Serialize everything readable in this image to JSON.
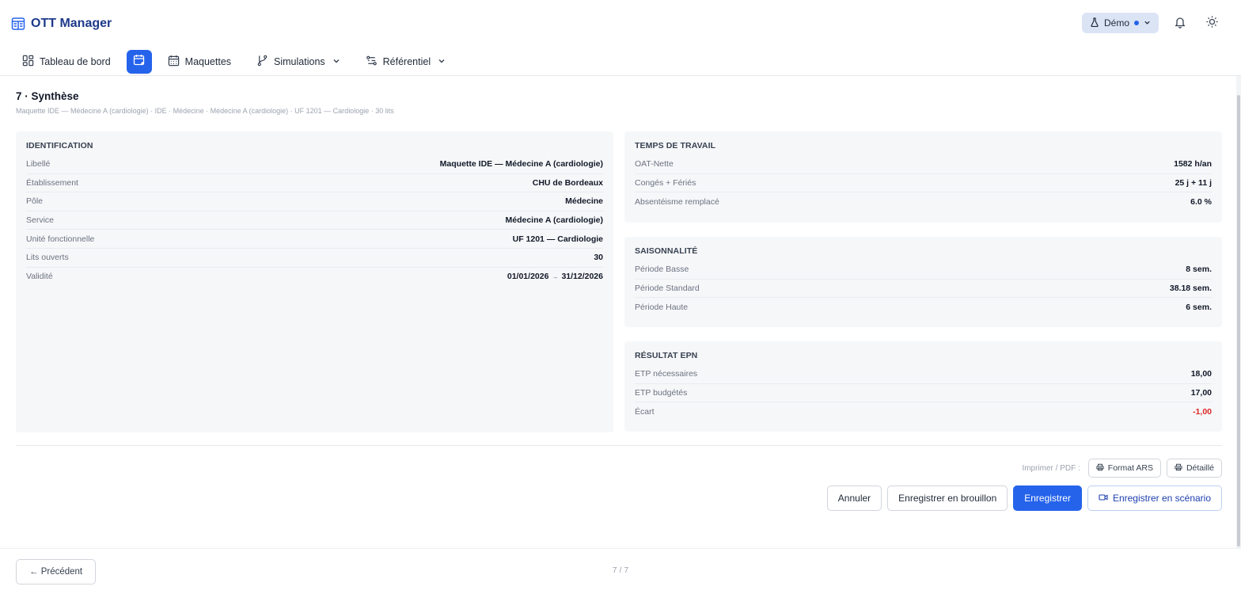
{
  "app": {
    "title": "OTT Manager"
  },
  "header": {
    "demo_label": "Démo"
  },
  "nav": {
    "items": [
      {
        "label": "Tableau de bord"
      },
      {
        "label": ""
      },
      {
        "label": "Maquettes"
      },
      {
        "label": "Simulations"
      },
      {
        "label": "Référentiel"
      }
    ]
  },
  "section": {
    "title": "7 · Synthèse",
    "subtitle": "Maquette IDE — Médecine A (cardiologie) · IDE · Médecine · Médecine A (cardiologie) · UF 1201 — Cardiologie · 30 lits"
  },
  "identification": {
    "title": "IDENTIFICATION",
    "rows": [
      {
        "k": "Libellé",
        "v": "Maquette IDE — Médecine A (cardiologie)"
      },
      {
        "k": "Établissement",
        "v": "CHU de Bordeaux"
      },
      {
        "k": "Pôle",
        "v": "Médecine"
      },
      {
        "k": "Service",
        "v": "Médecine A (cardiologie)"
      },
      {
        "k": "Unité fonctionnelle",
        "v": "UF 1201 — Cardiologie"
      },
      {
        "k": "Lits ouverts",
        "v": "30"
      }
    ],
    "validity": {
      "k": "Validité",
      "from": "01/01/2026",
      "arrow": "→",
      "to": "31/12/2026"
    }
  },
  "temps": {
    "title": "TEMPS DE TRAVAIL",
    "rows": [
      {
        "k": "OAT-Nette",
        "v": "1582 h/an"
      },
      {
        "k": "Congés + Fériés",
        "v": "25 j + 11 j"
      },
      {
        "k": "Absentéisme remplacé",
        "v": "6.0 %"
      }
    ]
  },
  "saison": {
    "title": "SAISONNALITÉ",
    "rows": [
      {
        "k": "Période Basse",
        "v": "8 sem."
      },
      {
        "k": "Période Standard",
        "v": "38.18 sem."
      },
      {
        "k": "Période Haute",
        "v": "6 sem."
      }
    ]
  },
  "epn": {
    "title": "RÉSULTAT EPN",
    "rows": [
      {
        "k": "ETP nécessaires",
        "v": "18,00"
      },
      {
        "k": "ETP budgétés",
        "v": "17,00"
      },
      {
        "k": "Écart",
        "v": "-1,00"
      }
    ]
  },
  "print": {
    "label": "Imprimer / PDF :",
    "format_ars": "Format ARS",
    "detaille": "Détaillé"
  },
  "actions": {
    "cancel": "Annuler",
    "draft": "Enregistrer en brouillon",
    "save": "Enregistrer",
    "scenario": "Enregistrer en scénario"
  },
  "footer": {
    "prev": "← Précédent",
    "pager": "7 / 7"
  },
  "colors": {
    "accent": "#2563eb",
    "negative": "#dc2626",
    "panel_bg": "#f6f7f9"
  }
}
